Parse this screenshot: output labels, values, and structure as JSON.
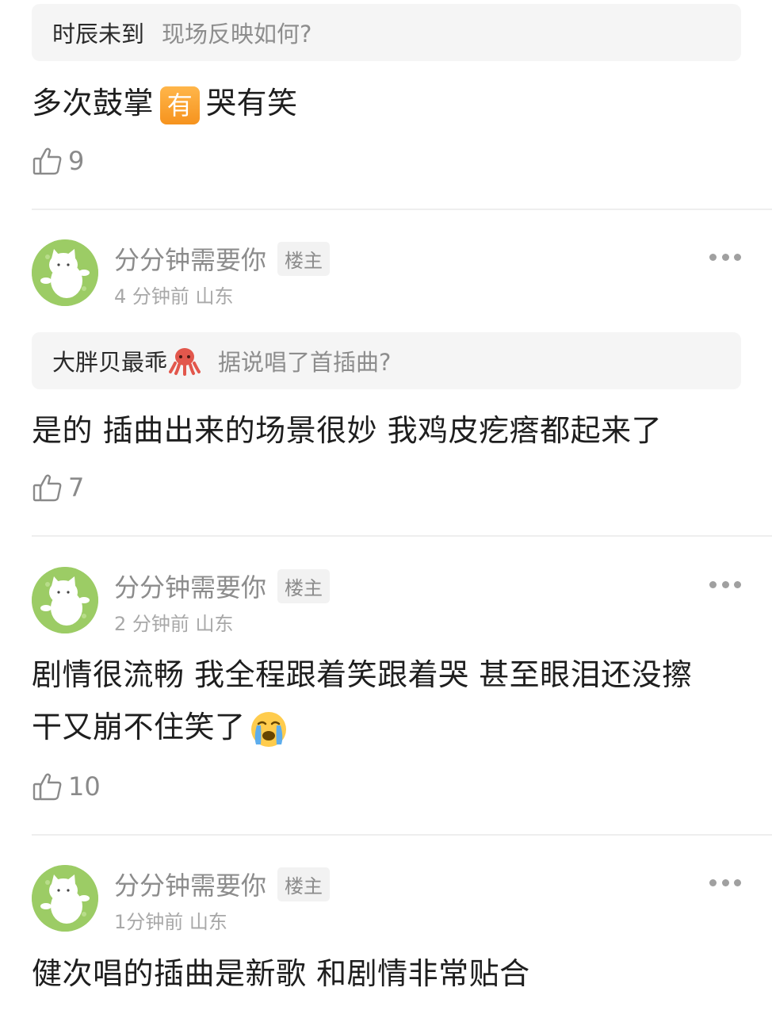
{
  "comment0": {
    "quote_name": "时辰未到",
    "quote_text": "现场反映如何?",
    "text_before": "多次鼓掌",
    "badge_char": "有",
    "text_after": "哭有笑",
    "likes": "9"
  },
  "comment1": {
    "username": "分分钟需要你",
    "badge": "楼主",
    "time": "4 分钟前",
    "location": "山东",
    "quote_name": "大胖贝最乖",
    "quote_text": "据说唱了首插曲?",
    "text": "是的 插曲出来的场景很妙 我鸡皮疙瘩都起来了",
    "likes": "7"
  },
  "comment2": {
    "username": "分分钟需要你",
    "badge": "楼主",
    "time": "2 分钟前",
    "location": "山东",
    "text_line1": "剧情很流畅 我全程跟着笑跟着哭 甚至眼泪还没擦",
    "text_line2": "干又崩不住笑了",
    "likes": "10"
  },
  "comment3": {
    "username": "分分钟需要你",
    "badge": "楼主",
    "time": "1分钟前",
    "location": "山东",
    "text": "健次唱的插曲是新歌 和剧情非常贴合"
  },
  "icons": {
    "like": "thumbs-up-icon",
    "more": "more-dots-icon",
    "octopus": "octopus-emoji-icon",
    "cry": "loudly-crying-emoji-icon"
  },
  "colors": {
    "badge_orange": "#f6931e",
    "avatar_green": "#9ccc65",
    "quote_bg": "#f5f5f5"
  }
}
